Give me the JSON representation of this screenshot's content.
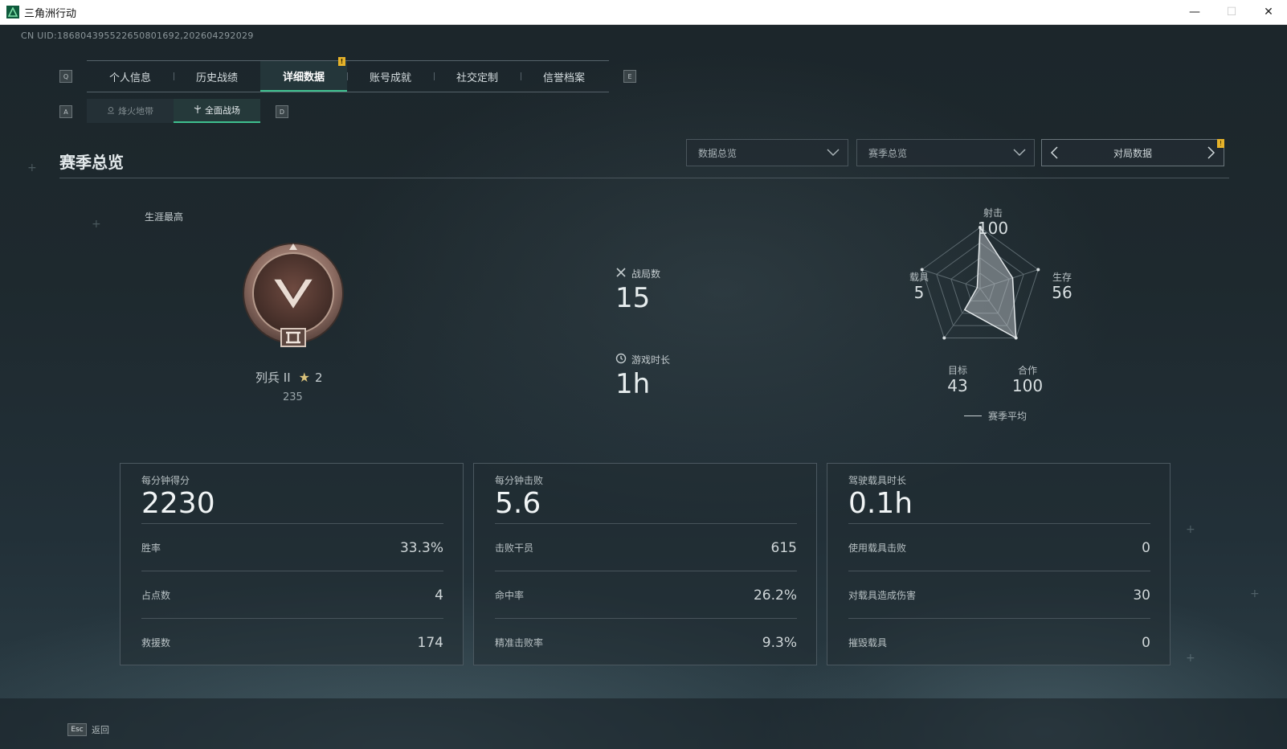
{
  "window": {
    "title": "三角洲行动",
    "controls": {
      "minimize": "—",
      "maximize": "☐",
      "close": "✕"
    }
  },
  "uid_text": "CN UID:1868043955226508016​92,202604292029",
  "nav": {
    "left_key": "Q",
    "right_key": "E",
    "tabs": [
      {
        "label": "个人信息"
      },
      {
        "label": "历史战绩"
      },
      {
        "label": "详细数据",
        "active": true,
        "badge": "!"
      },
      {
        "label": "账号成就"
      },
      {
        "label": "社交定制"
      },
      {
        "label": "信誉档案"
      }
    ]
  },
  "subnav": {
    "left_key": "A",
    "right_key": "D",
    "tabs": [
      {
        "label": "烽火地带"
      },
      {
        "label": "全面战场",
        "active": true
      }
    ]
  },
  "section": {
    "title": "赛季总览",
    "dropdown_data": "数据总览",
    "dropdown_season": "赛季总览",
    "pager_label": "对局数据",
    "pager_badge": "!"
  },
  "rank": {
    "career_label": "生涯最高",
    "name": "列兵 II",
    "stars": "2",
    "points": "235"
  },
  "match": {
    "battles_label": "战局数",
    "battles_value": "15",
    "playtime_label": "游戏时长",
    "playtime_value": "1h"
  },
  "radar": {
    "axes": [
      {
        "name": "射击",
        "value": "100",
        "score": 100
      },
      {
        "name": "生存",
        "value": "56",
        "score": 56
      },
      {
        "name": "合作",
        "value": "100",
        "score": 100
      },
      {
        "name": "目标",
        "value": "43",
        "score": 43
      },
      {
        "name": "载具",
        "value": "5",
        "score": 5
      }
    ],
    "legend": "赛季平均"
  },
  "panels": [
    {
      "head_label": "每分钟得分",
      "head_value": "2230",
      "rows": [
        {
          "k": "胜率",
          "v": "33.3%"
        },
        {
          "k": "占点数",
          "v": "4"
        },
        {
          "k": "救援数",
          "v": "174"
        }
      ]
    },
    {
      "head_label": "每分钟击败",
      "head_value": "5.6",
      "rows": [
        {
          "k": "击败干员",
          "v": "615"
        },
        {
          "k": "命中率",
          "v": "26.2%"
        },
        {
          "k": "精准击败率",
          "v": "9.3%"
        }
      ]
    },
    {
      "head_label": "驾驶载具时长",
      "head_value": "0.1h",
      "rows": [
        {
          "k": "使用载具击败",
          "v": "0"
        },
        {
          "k": "对载具造成伤害",
          "v": "30"
        },
        {
          "k": "摧毁载具",
          "v": "0"
        }
      ]
    }
  ],
  "footer": {
    "esc_key": "Esc",
    "esc_label": "返回"
  }
}
